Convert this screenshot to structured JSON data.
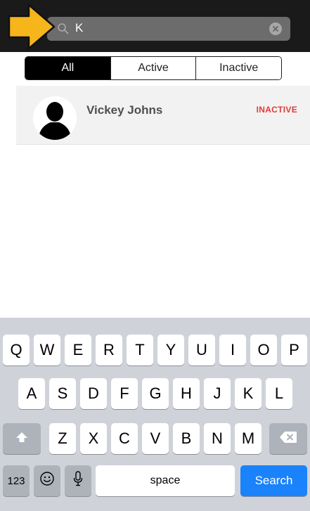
{
  "search": {
    "query": "K",
    "search_icon": "search-icon",
    "clear_icon": "clear-icon"
  },
  "annotation": {
    "arrow_icon": "arrow-right-icon",
    "arrow_color": "#f7b51c"
  },
  "segments": [
    {
      "label": "All",
      "selected": true
    },
    {
      "label": "Active",
      "selected": false
    },
    {
      "label": "Inactive",
      "selected": false
    }
  ],
  "contacts": [
    {
      "name": "Vickey Johns",
      "status": "INACTIVE",
      "avatar": "person-silhouette-icon"
    }
  ],
  "colors": {
    "status_inactive": "#e23a3a",
    "search_key": "#1a82fb",
    "selected_segment": "#000000"
  },
  "keyboard": {
    "row1": [
      "Q",
      "W",
      "E",
      "R",
      "T",
      "Y",
      "U",
      "I",
      "O",
      "P"
    ],
    "row2": [
      "A",
      "S",
      "D",
      "F",
      "G",
      "H",
      "J",
      "K",
      "L"
    ],
    "row3": [
      "Z",
      "X",
      "C",
      "V",
      "B",
      "N",
      "M"
    ],
    "numbers_label": "123",
    "space_label": "space",
    "search_label": "Search",
    "shift_icon": "shift-icon",
    "delete_icon": "delete-icon",
    "emoji_icon": "emoji-icon",
    "mic_icon": "mic-icon"
  }
}
